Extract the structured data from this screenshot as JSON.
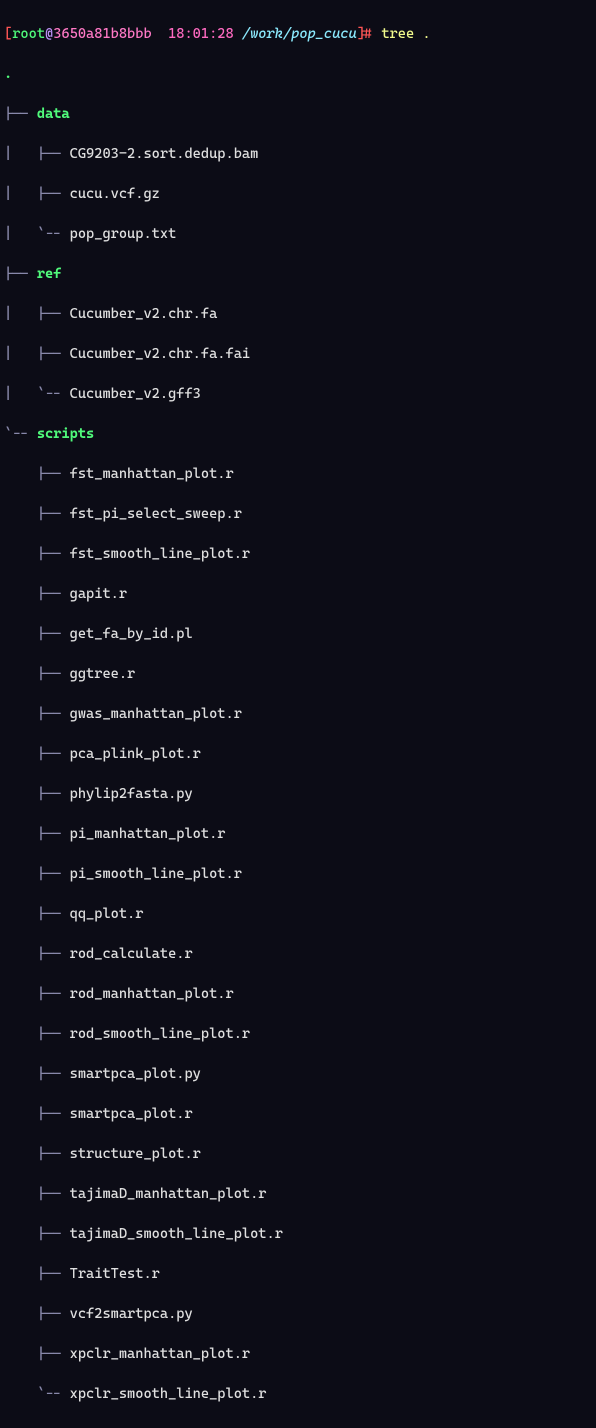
{
  "prompt": {
    "user": "root",
    "host": "3650a81b8bbb",
    "time": "18:01:28",
    "cwd": "/work/pop_cucu",
    "command": "tree .",
    "root_label": "."
  },
  "glyph": {
    "tee": "|-- ",
    "ell": "`-- ",
    "bar": "|   ",
    "pad": "    "
  },
  "dirs": {
    "data": {
      "name": "data"
    },
    "ref": {
      "name": "ref"
    },
    "scripts": {
      "name": "scripts"
    }
  },
  "files": {
    "data": [
      "CG9203-2.sort.dedup.bam",
      "cucu.vcf.gz",
      "pop_group.txt"
    ],
    "ref": [
      "Cucumber_v2.chr.fa",
      "Cucumber_v2.chr.fa.fai",
      "Cucumber_v2.gff3"
    ],
    "scripts": [
      "fst_manhattan_plot.r",
      "fst_pi_select_sweep.r",
      "fst_smooth_line_plot.r",
      "gapit.r",
      "get_fa_by_id.pl",
      "ggtree.r",
      "gwas_manhattan_plot.r",
      "pca_plink_plot.r",
      "phylip2fasta.py",
      "pi_manhattan_plot.r",
      "pi_smooth_line_plot.r",
      "qq_plot.r",
      "rod_calculate.r",
      "rod_manhattan_plot.r",
      "rod_smooth_line_plot.r",
      "smartpca_plot.py",
      "smartpca_plot.r",
      "structure_plot.r",
      "tajimaD_manhattan_plot.r",
      "tajimaD_smooth_line_plot.r",
      "TraitTest.r",
      "vcf2smartpca.py",
      "xpclr_manhattan_plot.r",
      "xpclr_smooth_line_plot.r"
    ]
  }
}
